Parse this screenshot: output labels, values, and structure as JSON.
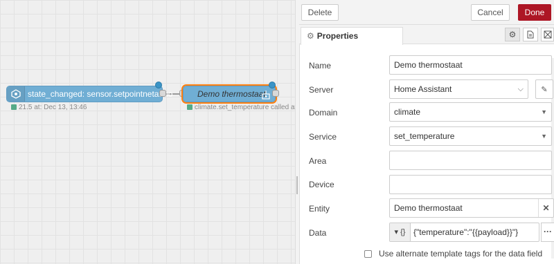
{
  "canvas": {
    "nodes": [
      {
        "label": "state_changed: sensor.setpointnetatmo",
        "status": "21.5 at: Dec 13, 13:46"
      },
      {
        "label": "Demo thermostaat",
        "status": "climate.set_temperature called at: D"
      }
    ]
  },
  "toolbar": {
    "delete_label": "Delete",
    "cancel_label": "Cancel",
    "done_label": "Done"
  },
  "tabs": {
    "properties_label": "Properties"
  },
  "form": {
    "name": {
      "label": "Name",
      "value": "Demo thermostaat"
    },
    "server": {
      "label": "Server",
      "value": "Home Assistant"
    },
    "domain": {
      "label": "Domain",
      "value": "climate"
    },
    "service": {
      "label": "Service",
      "value": "set_temperature"
    },
    "area": {
      "label": "Area",
      "value": ""
    },
    "device": {
      "label": "Device",
      "value": ""
    },
    "entity": {
      "label": "Entity",
      "value": "Demo thermostaat"
    },
    "data": {
      "label": "Data",
      "type_label": "{}",
      "value": "{\"temperature\":\"{{payload}}\"}"
    },
    "alt_template_label": "Use alternate template tags for the data field"
  },
  "colors": {
    "node": "#70aed4",
    "done_button": "#ad1625",
    "selection": "#ff7f0e"
  },
  "icons": [
    "home-assistant-node-icon",
    "service-call-node-icon",
    "gear-icon",
    "description-icon",
    "appearance-icon",
    "pencil-icon",
    "chevron-down-icon",
    "clear-icon",
    "expand-icon"
  ]
}
